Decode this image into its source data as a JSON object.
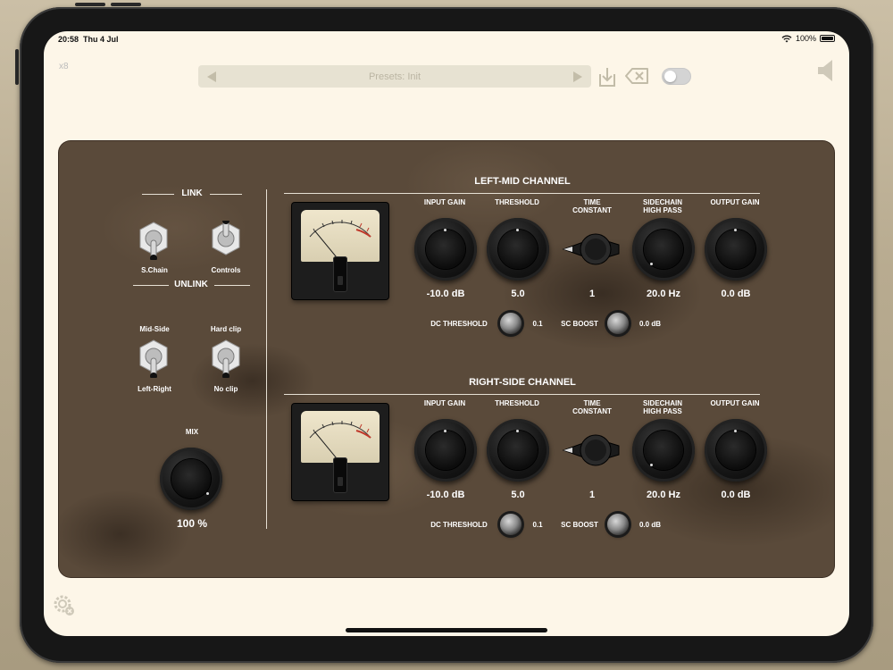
{
  "status": {
    "time": "20:58",
    "date": "Thu 4 Jul",
    "battery": "100%"
  },
  "toolbar": {
    "instance": "x8",
    "preset_label": "Presets: Init"
  },
  "left": {
    "link": "LINK",
    "schain": "S.Chain",
    "controls": "Controls",
    "unlink": "UNLINK",
    "midside": "Mid-Side",
    "hardclip": "Hard clip",
    "leftright": "Left-Right",
    "noclip": "No clip",
    "mix": "MIX",
    "mix_value": "100 %"
  },
  "labels": {
    "input_gain": "INPUT GAIN",
    "threshold": "THRESHOLD",
    "time": "TIME",
    "constant": "CONSTANT",
    "sidechain": "SIDECHAIN",
    "highpass": "HIGH PASS",
    "output_gain": "OUTPUT GAIN",
    "dc_threshold": "DC THRESHOLD",
    "sc_boost": "SC BOOST"
  },
  "channels": [
    {
      "title": "LEFT-MID CHANNEL",
      "input_gain": "-10.0 dB",
      "threshold": "5.0",
      "time_constant": "1",
      "sidechain_hp": "20.0 Hz",
      "output_gain": "0.0 dB",
      "dc_threshold": "0.1",
      "sc_boost": "0.0 dB"
    },
    {
      "title": "RIGHT-SIDE CHANNEL",
      "input_gain": "-10.0 dB",
      "threshold": "5.0",
      "time_constant": "1",
      "sidechain_hp": "20.0 Hz",
      "output_gain": "0.0 dB",
      "dc_threshold": "0.1",
      "sc_boost": "0.0 dB"
    }
  ]
}
